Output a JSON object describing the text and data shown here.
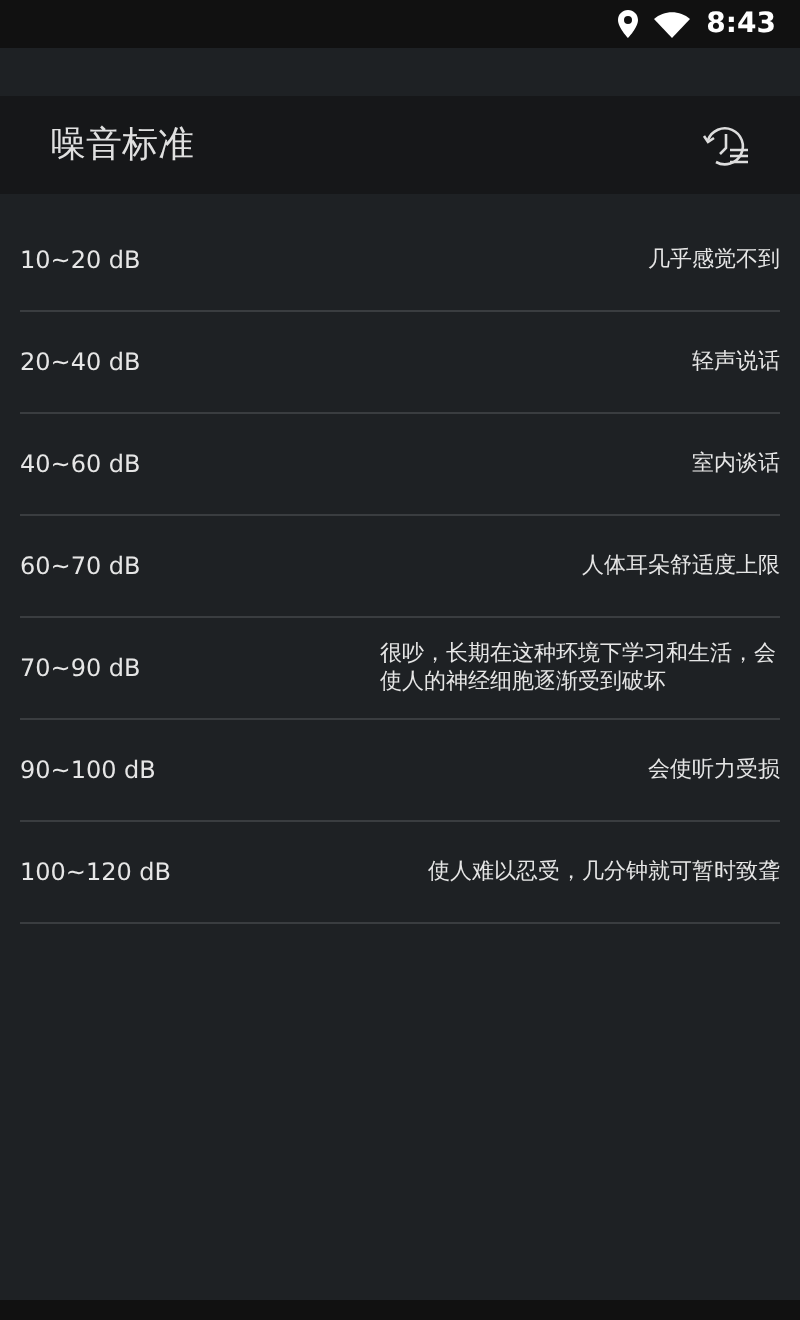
{
  "status_bar": {
    "time": "8:43"
  },
  "header": {
    "title": "噪音标准"
  },
  "rows": [
    {
      "level": "10~20 dB",
      "description": "几乎感觉不到"
    },
    {
      "level": "20~40 dB",
      "description": "轻声说话"
    },
    {
      "level": "40~60 dB",
      "description": "室内谈话"
    },
    {
      "level": "60~70 dB",
      "description": "人体耳朵舒适度上限"
    },
    {
      "level": "70~90 dB",
      "description": "很吵，长期在这种环境下学习和生活，会使人的神经细胞逐渐受到破坏"
    },
    {
      "level": "90~100 dB",
      "description": "会使听力受损"
    },
    {
      "level": "100~120 dB",
      "description": "使人难以忍受，几分钟就可暂时致聋"
    }
  ]
}
